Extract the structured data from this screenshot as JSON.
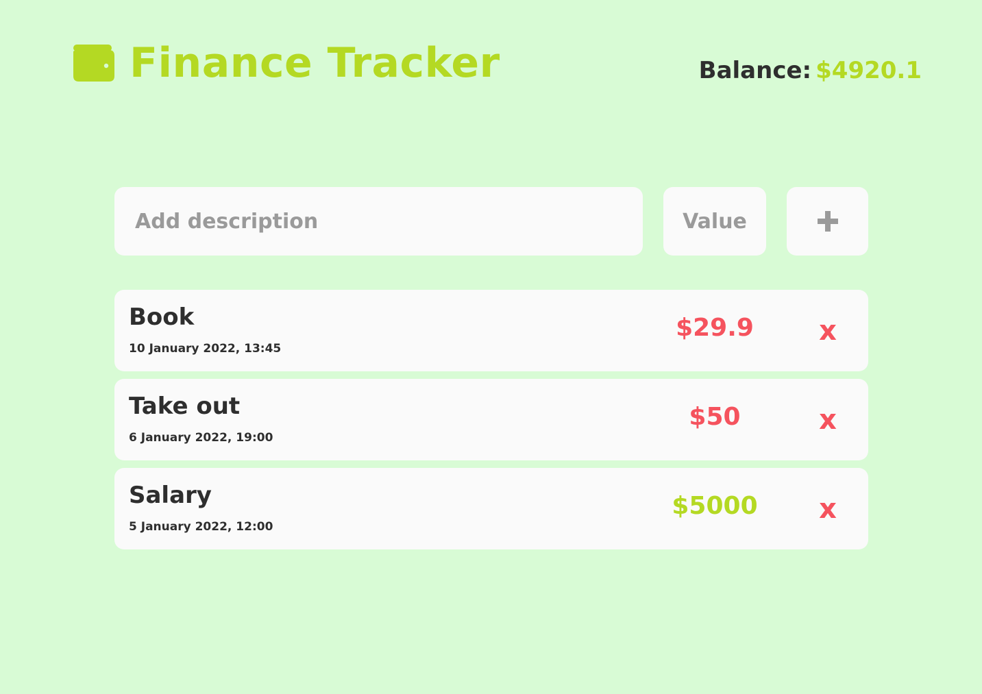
{
  "header": {
    "icon": "wallet-icon",
    "title": "Finance Tracker",
    "balance_label": "Balance:",
    "balance_value": "$4920.1"
  },
  "form": {
    "description_placeholder": "Add description",
    "value_placeholder": "Value",
    "add_icon": "plus-icon"
  },
  "transactions": [
    {
      "description": "Book",
      "date": "10 January 2022, 13:45",
      "amount": "$29.9",
      "type": "expense",
      "delete_label": "x"
    },
    {
      "description": "Take out",
      "date": "6 January 2022, 19:00",
      "amount": "$50",
      "type": "expense",
      "delete_label": "x"
    },
    {
      "description": "Salary",
      "date": "5 January 2022, 12:00",
      "amount": "$5000",
      "type": "income",
      "delete_label": "x"
    }
  ],
  "colors": {
    "background": "#d8fbd5",
    "accent": "#b4d923",
    "expense": "#f5535e",
    "income": "#b4d923",
    "card": "#fafafa",
    "text": "#2e2e2e",
    "placeholder": "#9a9a9a"
  }
}
